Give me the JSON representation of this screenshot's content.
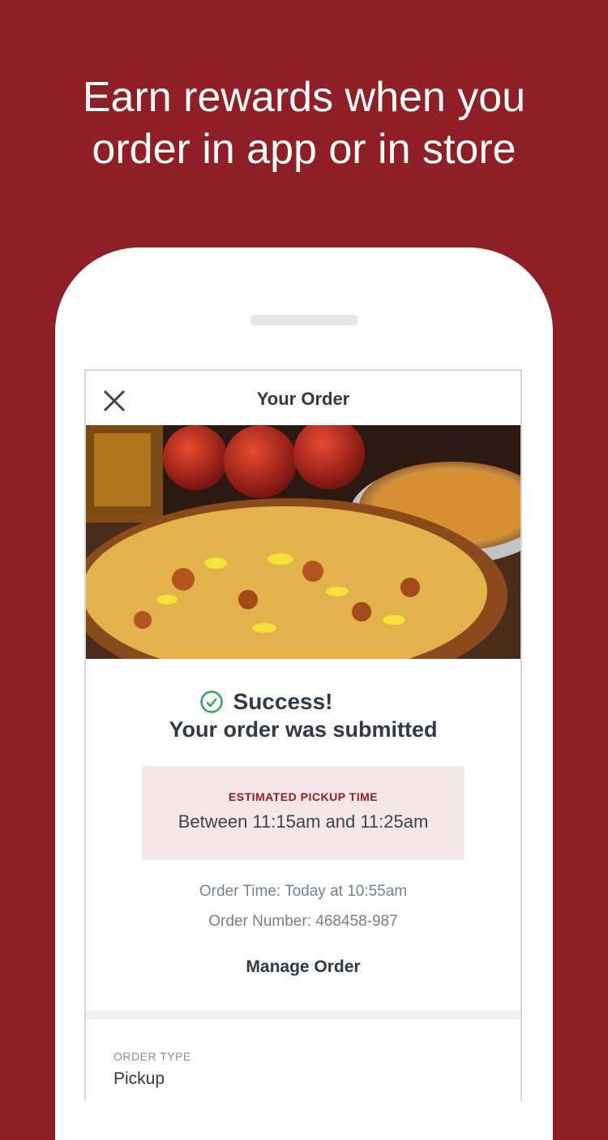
{
  "headline": {
    "line1": "Earn rewards when you",
    "line2": "order in app or in store"
  },
  "nav": {
    "title": "Your Order",
    "close_icon": "close-icon"
  },
  "hero": {
    "description_icon": "pizza-photo"
  },
  "status": {
    "icon": "check-circle-icon",
    "title": "Success!",
    "subtitle": "Your order was submitted",
    "icon_color": "#2fa65a"
  },
  "pickup": {
    "label": "ESTIMATED PICKUP TIME",
    "time": "Between 11:15am and 11:25am"
  },
  "order": {
    "time": "Order Time: Today at 10:55am",
    "number": "Order Number: 468458-987",
    "manage_label": "Manage Order"
  },
  "details": {
    "order_type_label": "ORDER TYPE",
    "order_type_value": "Pickup"
  },
  "colors": {
    "brand": "#8f1f24",
    "pickup_bg": "#f5e7e7",
    "text_dark": "#2f3a45"
  }
}
